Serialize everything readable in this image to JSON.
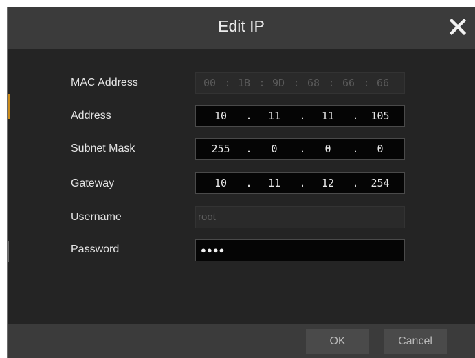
{
  "dialog": {
    "title": "Edit IP",
    "close_icon": "close-icon"
  },
  "form": {
    "mac": {
      "label": "MAC Address",
      "segments": [
        "00",
        "1B",
        "9D",
        "68",
        "66",
        "66"
      ],
      "separator": ":"
    },
    "address": {
      "label": "Address",
      "segments": [
        "10",
        "11",
        "11",
        "105"
      ],
      "separator": "."
    },
    "subnet": {
      "label": "Subnet Mask",
      "segments": [
        "255",
        "0",
        "0",
        "0"
      ],
      "separator": "."
    },
    "gateway": {
      "label": "Gateway",
      "segments": [
        "10",
        "11",
        "12",
        "254"
      ],
      "separator": "."
    },
    "username": {
      "label": "Username",
      "value": "root"
    },
    "password": {
      "label": "Password",
      "mask": "●●●●"
    }
  },
  "footer": {
    "ok_label": "OK",
    "cancel_label": "Cancel"
  },
  "colors": {
    "accent": "#c98a1a",
    "dialog_bg": "#242424",
    "bar_bg": "#3b3b3b",
    "field_bg": "#050505"
  }
}
